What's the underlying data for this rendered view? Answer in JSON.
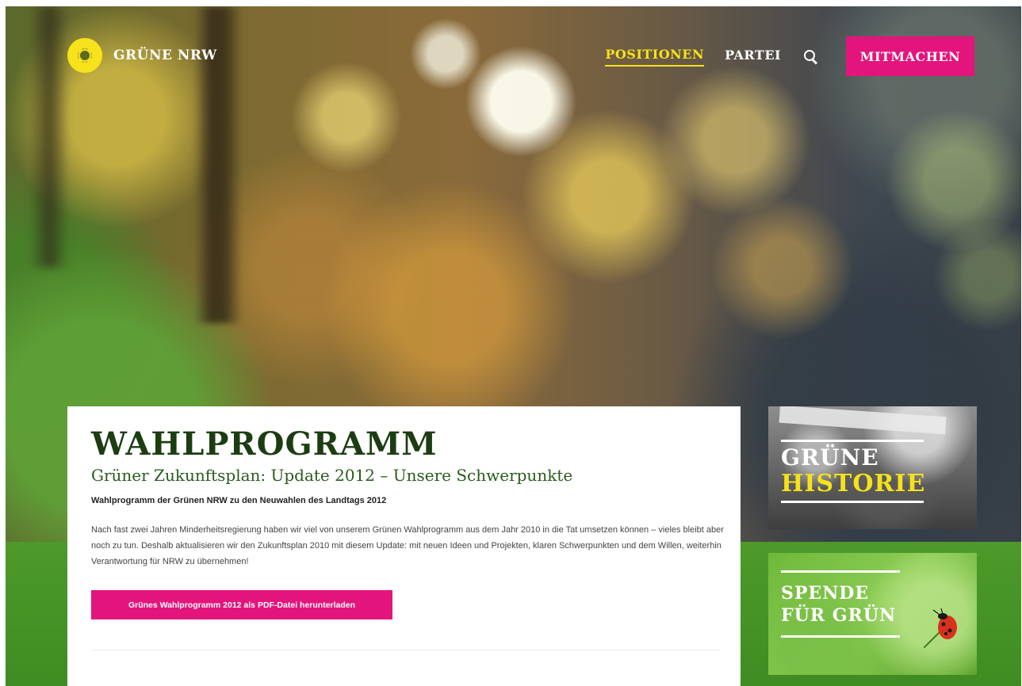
{
  "header": {
    "logo_text": "GRÜNE NRW",
    "nav": [
      {
        "label": "POSITIONEN",
        "active": true
      },
      {
        "label": "PARTEI",
        "active": false
      }
    ],
    "search_icon": "search-icon",
    "cta_label": "MITMACHEN"
  },
  "main": {
    "title": "WAHLPROGRAMM",
    "subtitle": "Grüner Zukunftsplan: Update 2012 – Unsere Schwerpunkte",
    "lead": "Wahlprogramm der Grünen NRW zu den Neuwahlen des Landtags 2012",
    "body": "Nach fast zwei Jahren Minderheitsregierung haben wir viel von unserem Grünen Wahlprogramm aus dem Jahr 2010 in die Tat umsetzen können – vieles bleibt aber noch zu tun. Deshalb aktualisieren wir den Zukunftsplan 2010 mit diesem Update: mit neuen Ideen und Projekten, klaren Schwerpunkten und dem Willen, weiterhin Verantwortung für NRW zu übernehmen!",
    "download_label": "Grünes Wahlprogramm 2012 als PDF-Datei herunterladen"
  },
  "sidebar": {
    "historie": {
      "line1": "GRÜNE",
      "line2": "HISTORIE"
    },
    "spende": {
      "line1": "SPENDE",
      "line2": "FÜR GRÜN"
    }
  },
  "colors": {
    "accent_magenta": "#e3157c",
    "accent_yellow": "#f6e21a",
    "title_green": "#1c3d12",
    "band_green": "#4d9a2a"
  }
}
